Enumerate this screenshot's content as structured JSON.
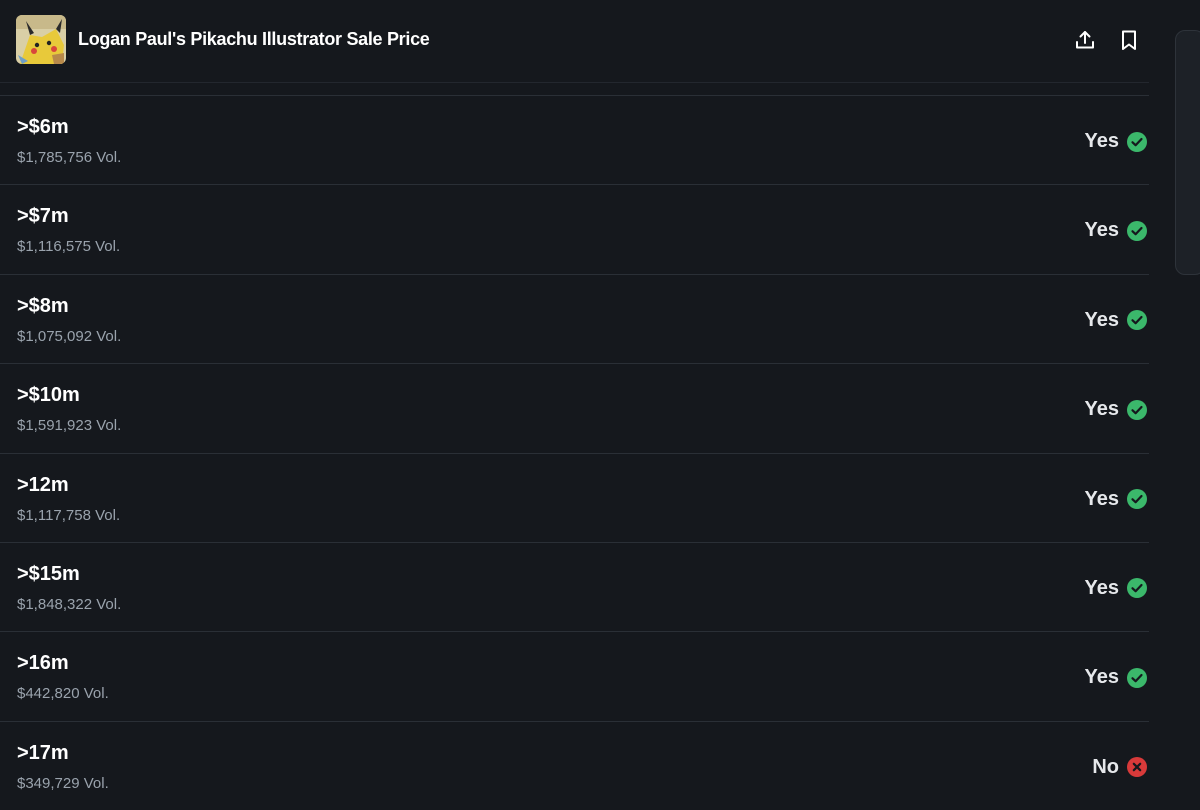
{
  "header": {
    "title": "Logan Paul's Pikachu Illustrator Sale Price",
    "thumbnail_icon": "pikachu-card-thumbnail",
    "share_icon": "share-icon",
    "bookmark_icon": "bookmark-icon"
  },
  "colors": {
    "background": "#15181d",
    "yes": "#3bb86b",
    "no": "#d83a3a",
    "muted_text": "#9aa3ad"
  },
  "markets": [
    {
      "label": ">$6m",
      "volume": "$1,785,756 Vol.",
      "outcome": "Yes",
      "status": "yes"
    },
    {
      "label": ">$7m",
      "volume": "$1,116,575 Vol.",
      "outcome": "Yes",
      "status": "yes"
    },
    {
      "label": ">$8m",
      "volume": "$1,075,092 Vol.",
      "outcome": "Yes",
      "status": "yes"
    },
    {
      "label": ">$10m",
      "volume": "$1,591,923 Vol.",
      "outcome": "Yes",
      "status": "yes"
    },
    {
      "label": ">12m",
      "volume": "$1,117,758 Vol.",
      "outcome": "Yes",
      "status": "yes"
    },
    {
      "label": ">$15m",
      "volume": "$1,848,322 Vol.",
      "outcome": "Yes",
      "status": "yes"
    },
    {
      "label": ">16m",
      "volume": "$442,820 Vol.",
      "outcome": "Yes",
      "status": "yes"
    },
    {
      "label": ">17m",
      "volume": "$349,729 Vol.",
      "outcome": "No",
      "status": "no"
    }
  ]
}
